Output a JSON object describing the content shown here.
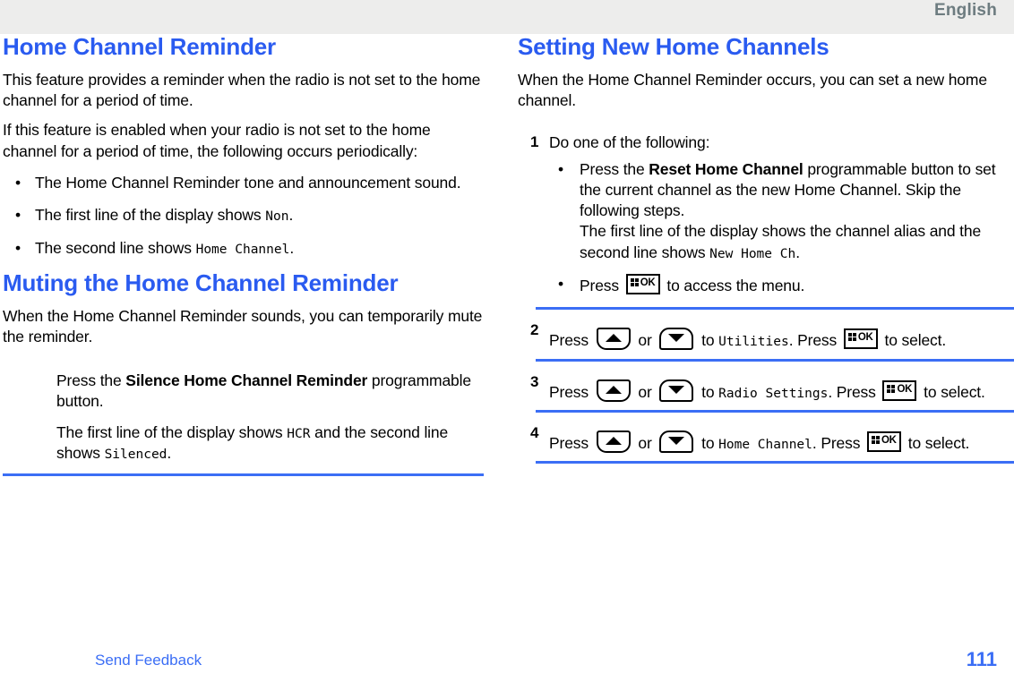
{
  "header": {
    "language": "English"
  },
  "left_column": {
    "section1": {
      "title": "Home Channel Reminder",
      "paragraph1": "This feature provides a reminder when the radio is not set to the home channel for a period of time.",
      "paragraph2": "If this feature is enabled when your radio is not set to the home channel for a period of time, the following occurs periodically:",
      "bullet_marker": "•",
      "bullets": [
        {
          "text": "The Home Channel Reminder tone and announcement sound."
        },
        {
          "pre": "The first line of the display shows ",
          "mono": "Non",
          "post": "."
        },
        {
          "pre": "The second line shows ",
          "mono": "Home Channel",
          "post": "."
        }
      ]
    },
    "section2": {
      "title": "Muting the Home Channel Reminder",
      "paragraph1": "When the Home Channel Reminder sounds, you can temporarily mute the reminder.",
      "step_pre": "Press the ",
      "step_bold": "Silence Home Channel Reminder",
      "step_post": " programmable button.",
      "result_pre": "The first line of the display shows ",
      "result_mono1": "HCR",
      "result_mid": " and the second line shows ",
      "result_mono2": "Silenced",
      "result_post": "."
    }
  },
  "right_column": {
    "title": "Setting New Home Channels",
    "intro": "When the Home Channel Reminder occurs, you can set a new home channel.",
    "bullet_marker": "•",
    "steps": [
      {
        "number": "1",
        "text": "Do one of the following:",
        "substeps": [
          {
            "pre": "Press the ",
            "bold": "Reset Home Channel",
            "mid": " programmable button to set the current channel as the new Home Channel. Skip the following steps.",
            "line2_pre": "The first line of the display shows the channel alias and the second line shows ",
            "line2_mono": "New Home Ch",
            "line2_post": "."
          },
          {
            "pre": "Press ",
            "key": "ok-key",
            "post": " to access the menu."
          }
        ]
      },
      {
        "number": "2",
        "p1": "Press ",
        "key1": "up-key",
        "p2": " or ",
        "key2": "down-key",
        "p3": " to ",
        "mono": "Utilities",
        "p4": ". Press ",
        "key3": "ok-key",
        "p5": " to select."
      },
      {
        "number": "3",
        "p1": "Press ",
        "key1": "up-key",
        "p2": " or ",
        "key2": "down-key",
        "p3": " to ",
        "mono": "Radio Settings",
        "p4": ". Press ",
        "key3": "ok-key",
        "p5": " to select."
      },
      {
        "number": "4",
        "p1": "Press ",
        "key1": "up-key",
        "p2": " or ",
        "key2": "down-key",
        "p3": " to ",
        "mono": "Home Channel",
        "p4": ". Press ",
        "key3": "ok-key",
        "p5": " to select."
      }
    ]
  },
  "keys": {
    "ok_label": "OK"
  },
  "footer": {
    "feedback_link": "Send Feedback",
    "page_number": "111"
  },
  "colors": {
    "heading_blue": "#2a5bf0",
    "rule_blue": "#3b6ef5",
    "header_bg": "#ededec",
    "lang_text": "#6d7c80"
  }
}
